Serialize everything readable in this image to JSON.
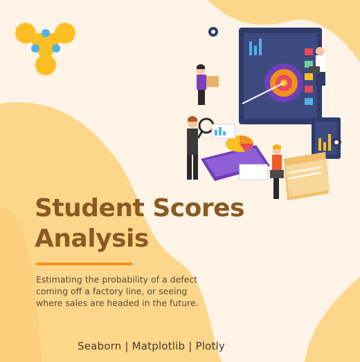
{
  "title": {
    "line1": "Student Scores",
    "line2": "Analysis"
  },
  "description": "Estimating the probability of a defect coming off a factory line, or seeing where sales are headed in the future.",
  "footer": {
    "libraries": "Seaborn | Matplotlib | Plotly"
  },
  "logo": {
    "icon": "three-node-network-icon"
  },
  "illustration": {
    "icon": "data-analytics-team-illustration"
  },
  "colors": {
    "background": "#fdf3e6",
    "blob": "#fcd68a",
    "title": "#8a5a23",
    "accent": "#f2921c",
    "logo_yellow": "#fbbf24",
    "logo_blue": "#4fb3e6"
  }
}
